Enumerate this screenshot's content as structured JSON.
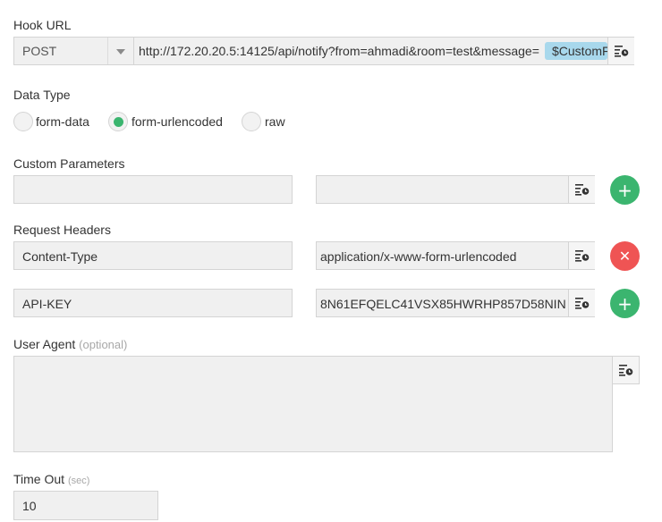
{
  "hook_url": {
    "label": "Hook URL",
    "method": "POST",
    "url": "http://172.20.20.5:14125/api/notify?from=ahmadi&room=test&message=",
    "token": "$CustomF"
  },
  "data_type": {
    "label": "Data Type",
    "options": [
      "form-data",
      "form-urlencoded",
      "raw"
    ],
    "selected": "form-urlencoded"
  },
  "custom_parameters": {
    "label": "Custom Parameters",
    "name_value": "",
    "value_value": ""
  },
  "request_headers": {
    "label": "Request Headers",
    "rows": [
      {
        "name": "Content-Type",
        "value": "application/x-www-form-urlencoded"
      },
      {
        "name": "API-KEY",
        "value": "8N61EFQELC41VSX85HWRHP857D58NIN"
      }
    ]
  },
  "user_agent": {
    "label": "User Agent",
    "optional": "(optional)",
    "value": ""
  },
  "time_out": {
    "label": "Time Out",
    "unit": "(sec)",
    "value": "10"
  },
  "icons": {
    "variable_insert": "variable-insert-icon",
    "add": "plus-icon",
    "remove": "close-icon",
    "dropdown": "caret-down-icon"
  },
  "colors": {
    "accent_green": "#3bb56f",
    "danger_red": "#ef5454",
    "token_blue": "#a8d8ec",
    "field_bg": "#f0f0f0"
  }
}
